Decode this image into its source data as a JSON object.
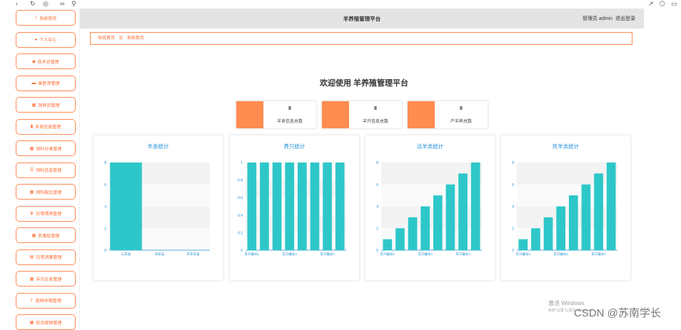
{
  "browser": {
    "icons": [
      "back-icon",
      "refresh-icon",
      "globe-icon",
      "link-icon",
      "extension-icon",
      "share-icon",
      "box-icon",
      "window-icon"
    ]
  },
  "sidebar": {
    "items": [
      {
        "label": "系统首页",
        "icon": "home-icon"
      },
      {
        "label": "个人中心",
        "icon": "user-icon"
      },
      {
        "label": "技术员管理",
        "icon": "pin-icon"
      },
      {
        "label": "兽医师管理",
        "icon": "monitor-icon"
      },
      {
        "label": "饲养员管理",
        "icon": "grid-icon"
      },
      {
        "label": "羊舍信息管理",
        "icon": "bar-chart-icon"
      },
      {
        "label": "饲料分类管理",
        "icon": "table-icon"
      },
      {
        "label": "饲料信息管理",
        "icon": "list-icon"
      },
      {
        "label": "饲料配比管理",
        "icon": "grid-icon"
      },
      {
        "label": "日常喂养管理",
        "icon": "trophy-icon"
      },
      {
        "label": "防毒疫管理",
        "icon": "grid-icon"
      },
      {
        "label": "日常消毒管理",
        "icon": "database-icon"
      },
      {
        "label": "羊只买卖管理",
        "icon": "grid-icon"
      },
      {
        "label": "配种孕期管理",
        "icon": "upload-icon"
      },
      {
        "label": "权员接种管理",
        "icon": "grid-icon"
      }
    ]
  },
  "header": {
    "title": "羊养殖管理平台",
    "user": "管理员 admin",
    "logout": "退出登录"
  },
  "breadcrumb": {
    "root": "系统首页",
    "sep": "☰",
    "current": "系统首页"
  },
  "welcome": "欢迎使用 羊养殖管理平台",
  "cards": [
    {
      "value": "8",
      "label": "羊舍信息总数"
    },
    {
      "value": "8",
      "label": "羊只信息总数"
    },
    {
      "value": "8",
      "label": "产羊养总数"
    }
  ],
  "colors": {
    "accent": "#ff8c50",
    "bar": "#2ec7c9",
    "title": "#1f8fd8"
  },
  "chart_data": [
    {
      "type": "bar",
      "title": "羊舍统计",
      "categories": [
        "公羊舍",
        "母羊舍",
        "羔羊羊舍"
      ],
      "values": [
        8,
        0,
        0
      ],
      "ylim": [
        0,
        8
      ],
      "yticks": [
        0,
        2,
        4,
        6,
        8
      ]
    },
    {
      "type": "bar",
      "title": "养只统计",
      "categories": [
        "羊只编号1",
        "羊只编号2",
        "羊只编号3",
        "羊只编号4",
        "羊只编号5",
        "羊只编号6",
        "羊只编号7",
        "羊只编号8"
      ],
      "xticklabels": [
        "羊只编号1",
        "羊只编号4",
        "羊只编号7"
      ],
      "values": [
        1,
        1,
        1,
        1,
        1,
        1,
        1,
        1
      ],
      "ylim": [
        0,
        1
      ],
      "yticks": [
        0,
        0.2,
        0.4,
        0.6,
        0.8,
        1
      ]
    },
    {
      "type": "bar",
      "title": "活羊羔统计",
      "categories": [
        "羊只编号1",
        "羊只编号2",
        "羊只编号3",
        "羊只编号4",
        "羊只编号5",
        "羊只编号6",
        "羊只编号7",
        "羊只编号8"
      ],
      "xticklabels": [
        "羊只编号1",
        "羊只编号4",
        "羊只编号7"
      ],
      "values": [
        1,
        2,
        3,
        4,
        5,
        6,
        7,
        8
      ],
      "ylim": [
        0,
        8
      ],
      "yticks": [
        0,
        2,
        4,
        6,
        8
      ]
    },
    {
      "type": "bar",
      "title": "死羊羔统计",
      "categories": [
        "羊只编号1",
        "羊只编号2",
        "羊只编号3",
        "羊只编号4",
        "羊只编号5",
        "羊只编号6",
        "羊只编号7",
        "羊只编号8"
      ],
      "xticklabels": [
        "羊只编号1",
        "羊只编号4",
        "羊只编号7"
      ],
      "values": [
        1,
        2,
        3,
        4,
        5,
        6,
        7,
        8
      ],
      "ylim": [
        0,
        8
      ],
      "yticks": [
        0,
        2,
        4,
        6,
        8
      ]
    }
  ],
  "watermark": {
    "line1": "激活 Windows",
    "line2": "转到\"设置\"以激活 Windows。",
    "csdn": "CSDN @苏南学长"
  }
}
